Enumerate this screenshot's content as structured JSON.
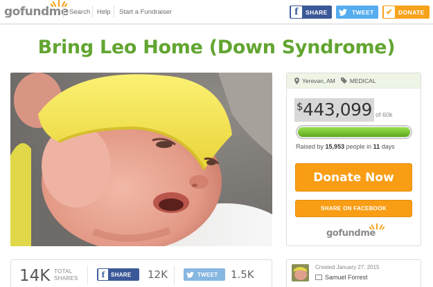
{
  "header": {
    "logo_go": "go",
    "logo_fund": "fund",
    "logo_me": "me",
    "nav": [
      "Search",
      "Help",
      "Start a Fundraiser"
    ],
    "share_facebook": "SHARE",
    "share_twitter": "TWEET",
    "donate": "DONATE"
  },
  "campaign": {
    "title": "Bring Leo Home (Down Syndrome)",
    "location": "Yerevan, AM",
    "category": "MEDICAL",
    "currency": "$",
    "amount_raised": "443,099",
    "goal": "of 60k",
    "progress_fraction": 1.0,
    "raised_prefix": "Raised by",
    "people_count": "15,953",
    "people_label": "people in",
    "days": "11",
    "days_label": "days",
    "donate_now": "Donate Now",
    "share_on_facebook": "SHARE ON FACEBOOK"
  },
  "shares": {
    "total": "14K",
    "total_label_1": "TOTAL",
    "total_label_2": "SHARES",
    "facebook_label": "SHARE",
    "facebook_count": "12K",
    "twitter_label": "TWEET",
    "twitter_count": "1.5K"
  },
  "creator": {
    "created": "Created January 27, 2015",
    "name": "Samuel Forrest"
  },
  "colors": {
    "brand_green": "#62a531",
    "donate_orange": "#f89d14",
    "facebook_blue": "#3b5998",
    "twitter_blue": "#55acee"
  },
  "icons": [
    "facebook-icon",
    "twitter-icon",
    "checkmark-icon",
    "location-pin-icon",
    "tag-icon",
    "mail-icon"
  ]
}
